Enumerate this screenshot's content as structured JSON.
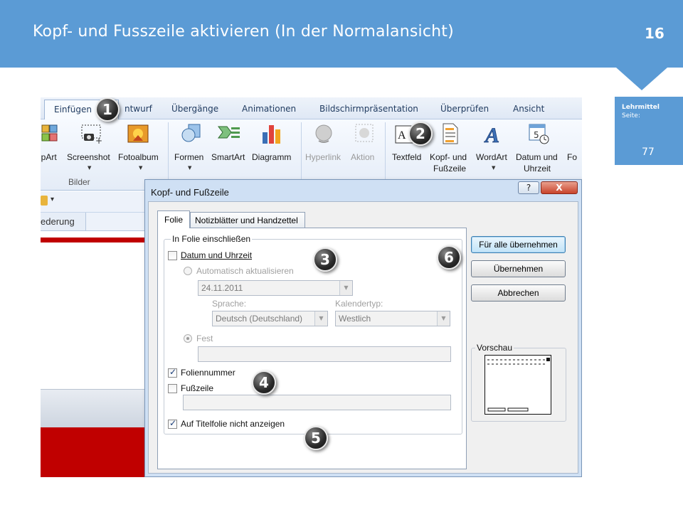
{
  "header": {
    "title": "Kopf- und Fusszeile aktivieren (In der Normalansicht)",
    "page_number": "16"
  },
  "side_box": {
    "title": "Lehrmittel",
    "subtitle": "Seite:",
    "page": "77"
  },
  "ribbon": {
    "tabs": [
      "Einfügen",
      "ntwurf",
      "Übergänge",
      "Animationen",
      "Bildschirmpräsentation",
      "Überprüfen",
      "Ansicht"
    ],
    "groups": {
      "bilder": "Bilder"
    },
    "buttons": {
      "clipart": "ipArt",
      "screenshot": "Screenshot",
      "fotoalbum": "Fotoalbum",
      "formen": "Formen",
      "smartart": "SmartArt",
      "diagramm": "Diagramm",
      "hyperlink": "Hyperlink",
      "aktion": "Aktion",
      "textfeld": "Textfeld",
      "kopfzeile_1": "Kopf- und",
      "kopfzeile_2": "Fußzeile",
      "wordart": "WordArt",
      "datum_1": "Datum und",
      "datum_2": "Uhrzeit",
      "folie": "Fo"
    }
  },
  "background_pane": {
    "outline_tab": "ederung"
  },
  "dialog": {
    "title": "Kopf- und Fußzeile",
    "help_label": "?",
    "close_label": "X",
    "tabs": [
      "Folie",
      "Notizblätter und Handzettel"
    ],
    "group_label": "In Folie einschließen",
    "date_time": {
      "label": "Datum und Uhrzeit",
      "checked": false
    },
    "auto_update": {
      "label": "Automatisch aktualisieren",
      "selected": false
    },
    "date_value": "24.11.2011",
    "language": {
      "label": "Sprache:",
      "value": "Deutsch (Deutschland)"
    },
    "calendar": {
      "label": "Kalendertyp:",
      "value": "Westlich"
    },
    "fixed": {
      "label": "Fest",
      "selected": true,
      "value": ""
    },
    "slide_number": {
      "label": "Foliennummer",
      "checked": true
    },
    "footer": {
      "label": "Fußzeile",
      "checked": false,
      "value": ""
    },
    "title_slide": {
      "label": "Auf Titelfolie nicht anzeigen",
      "checked": true
    },
    "buttons": {
      "apply_all": "Für alle übernehmen",
      "apply": "Übernehmen",
      "cancel": "Abbrechen"
    },
    "preview_label": "Vorschau"
  },
  "badges": [
    "1",
    "2",
    "3",
    "4",
    "5",
    "6"
  ]
}
